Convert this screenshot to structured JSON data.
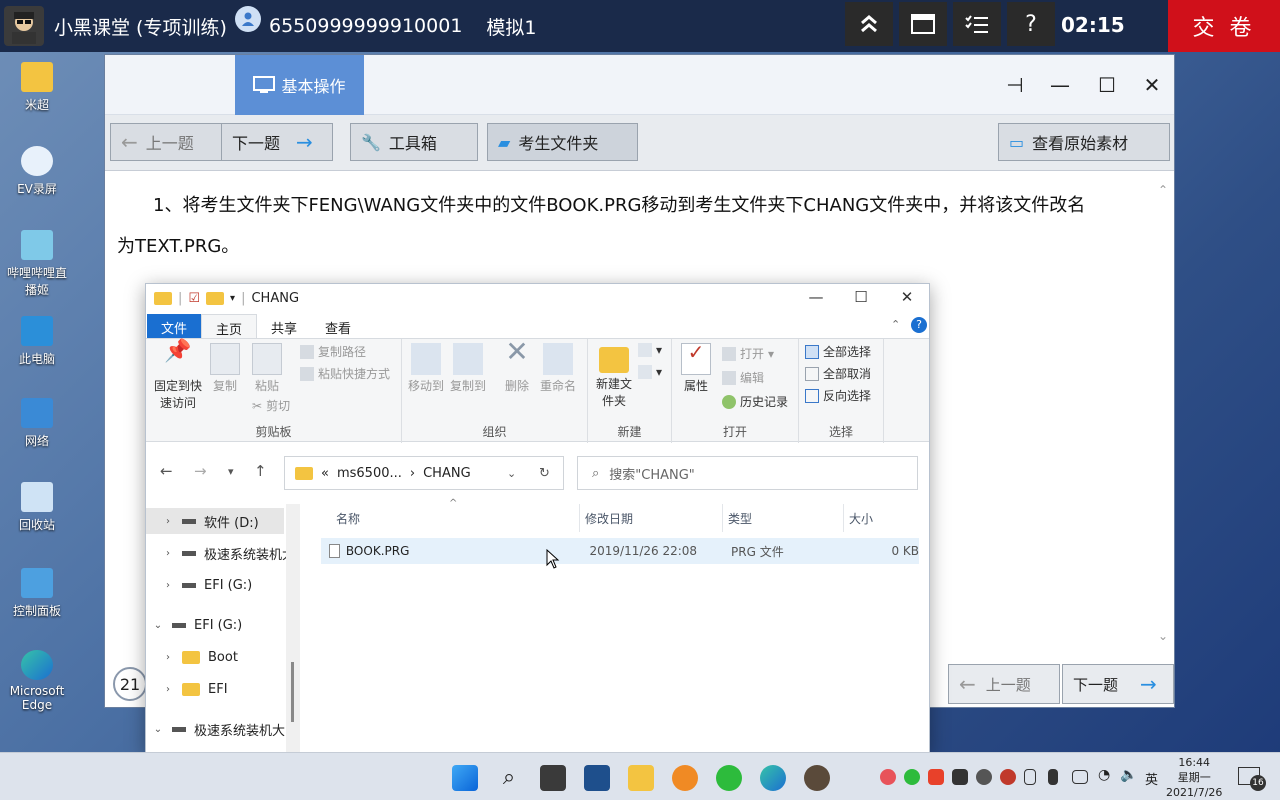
{
  "topbar": {
    "app_title": "小黑课堂 (专项训练)",
    "exam_id": "6550999999910001",
    "mode": "模拟1",
    "timer": "02:15",
    "submit_label": "交 卷"
  },
  "desktop_icons": [
    "米超",
    "EV录屏",
    "哔哩哔哩直播姬",
    "此电脑",
    "网络",
    "回收站",
    "控制面板",
    "Microsoft Edge"
  ],
  "exam": {
    "tab_label": "基本操作",
    "toolbar": {
      "prev": "上一题",
      "next": "下一题",
      "toolbox": "工具箱",
      "exam_folder": "考生文件夹",
      "view_source": "查看原始素材"
    },
    "question_line1": "1、将考生文件夹下FENG\\WANG文件夹中的文件BOOK.PRG移动到考生文件夹下CHANG文件夹中，并将该文件改名",
    "question_line2": "为TEXT.PRG。",
    "question_number": "21",
    "bottom_prev": "上一题",
    "bottom_next": "下一题"
  },
  "explorer": {
    "title": "CHANG",
    "tabs": [
      "文件",
      "主页",
      "共享",
      "查看"
    ],
    "ribbon": {
      "pin_quick_access": "固定到快速访问",
      "copy": "复制",
      "paste": "粘贴",
      "copy_path": "复制路径",
      "paste_shortcut": "粘贴快捷方式",
      "cut": "剪切",
      "group_clipboard": "剪贴板",
      "move_to": "移动到",
      "copy_to": "复制到",
      "delete": "删除",
      "rename": "重命名",
      "group_organize": "组织",
      "new_folder": "新建文件夹",
      "group_new": "新建",
      "properties": "属性",
      "open": "打开",
      "edit": "编辑",
      "history": "历史记录",
      "group_open": "打开",
      "select_all": "全部选择",
      "select_none": "全部取消",
      "invert_selection": "反向选择",
      "group_select": "选择"
    },
    "address": {
      "prefix": "«",
      "parent": "ms6500...",
      "current": "CHANG"
    },
    "search_placeholder": "搜索\"CHANG\"",
    "nav_items": [
      {
        "label": "软件 (D:)",
        "type": "drive"
      },
      {
        "label": "极速系统装机大",
        "type": "drive"
      },
      {
        "label": "EFI (G:)",
        "type": "drive"
      },
      {
        "label": "EFI (G:)",
        "type": "drive"
      },
      {
        "label": "Boot",
        "type": "folder"
      },
      {
        "label": "EFI",
        "type": "folder"
      },
      {
        "label": "极速系统装机大师",
        "type": "drive"
      }
    ],
    "columns": [
      "名称",
      "修改日期",
      "类型",
      "大小"
    ],
    "files": [
      {
        "name": "BOOK.PRG",
        "modified": "2019/11/26 22:08",
        "type": "PRG 文件",
        "size": "0 KB"
      }
    ]
  },
  "taskbar": {
    "ime": "英",
    "time": "16:44",
    "weekday": "星期一",
    "date": "2021/7/26",
    "notifications": "16"
  },
  "colors": {
    "topbar_bg": "#1a2a4a",
    "submit_bg": "#d0101a",
    "exam_tab_bg": "#5c8fd6",
    "file_tab_bg": "#1a6fd1"
  }
}
